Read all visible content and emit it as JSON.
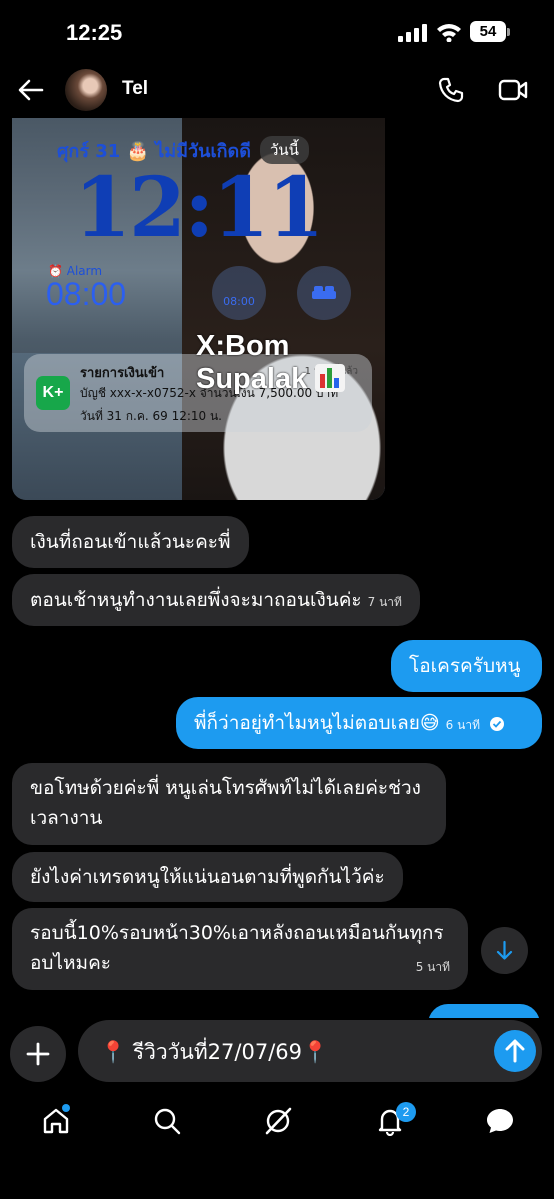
{
  "status_bar": {
    "time": "12:25",
    "battery": "54"
  },
  "header": {
    "contact_name": "Tel"
  },
  "shared_image": {
    "date_line": "ศุกร์ 31 🎂 ไม่มีวันเกิดดี",
    "today_pill": "วันนี้",
    "date_suffix": "วันนี้",
    "clock": "12:11",
    "alarm_label": "⏰ Alarm",
    "alarm_time": "08:00",
    "widget_alarm": "08:00",
    "notification": {
      "app_logo": "K+",
      "title": "รายการเงินเข้า",
      "time": "1 นาทีที่แล้ว",
      "line1": "บัญชี xxx-x-x0752-x   จำนวนเงิน 7,500.00 บาท",
      "line2": "วันที่ 31 ก.ค. 69  12:10 น."
    },
    "watermark": "X:Bom Supalak"
  },
  "messages": [
    {
      "dir": "in",
      "text": "เงินที่ถอนเข้าแล้วนะคะพี่"
    },
    {
      "dir": "in",
      "text": "ตอนเช้าหนูทำงานเลยพึ่งจะมาถอนเงินค่ะ",
      "time": "7 นาที"
    },
    {
      "dir": "out",
      "text": "โอเครครับหนู"
    },
    {
      "dir": "out",
      "text": "พี่ก็ว่าอยู่ทำไมหนูไม่ตอบเลย😅",
      "time": "6 นาที"
    },
    {
      "dir": "in",
      "text_line1": "ขอโทษด้วยค่ะพี่ หนูเล่นโทรศัพท์ไม่ได้เลยค่ะช่วง",
      "text_line2": "เวลางาน"
    },
    {
      "dir": "in",
      "text": "ยังไงค่าเทรดหนูให้แน่นอนตามที่พูดกันไว้ค่ะ"
    },
    {
      "dir": "in",
      "text_line1": "รอบนี้10%รอบหน้า30%เอาหลังถอนเหมือนกันทุกร",
      "text_line2": "อบไหมคะ",
      "time": "5 นาที"
    }
  ],
  "composer": {
    "value": "📍 รีวิววันที่27/07/69📍"
  },
  "bottom_nav": {
    "notifications_badge": "2"
  },
  "colors": {
    "accent": "#1d9bf0",
    "incoming_bubble": "#2a2a2c",
    "background": "#000000"
  }
}
